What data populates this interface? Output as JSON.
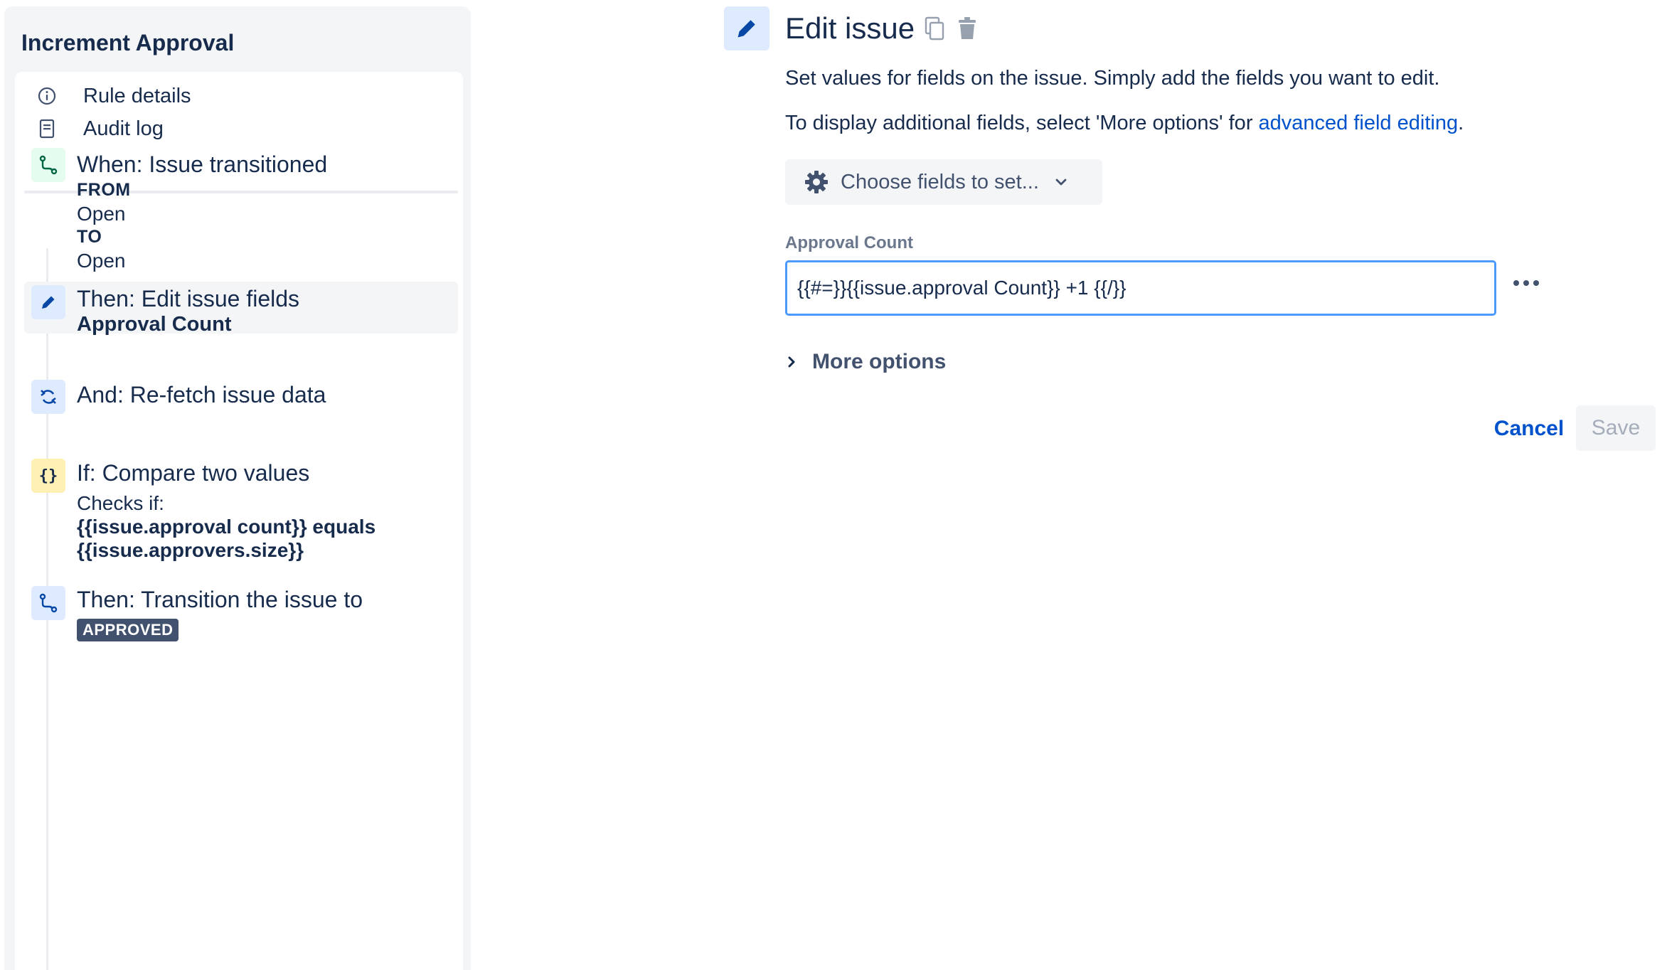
{
  "sidebar": {
    "title": "Increment Approval",
    "nav": [
      {
        "label": "Rule details",
        "icon": "info-icon"
      },
      {
        "label": "Audit log",
        "icon": "document-icon"
      }
    ],
    "components": [
      {
        "title": "When: Issue transitioned",
        "from_label": "FROM",
        "from_value": "Open",
        "to_label": "TO",
        "to_value": "Open",
        "icon": "transition-icon"
      },
      {
        "title": "Then: Edit issue fields",
        "field": "Approval Count",
        "icon": "pencil-icon",
        "selected": true
      },
      {
        "title": "And: Re-fetch issue data",
        "icon": "refresh-icon"
      },
      {
        "title": "If: Compare two values",
        "checks_label": "Checks if:",
        "expr_line1": "{{issue.approval count}} equals",
        "expr_line2": "{{issue.approvers.size}}",
        "icon": "curly-braces-icon"
      },
      {
        "title": "Then: Transition the issue to",
        "status": "APPROVED",
        "icon": "transition-icon"
      }
    ]
  },
  "main": {
    "title": "Edit issue",
    "description1": "Set values for fields on the issue. Simply add the fields you want to edit.",
    "description2_prefix": "To display additional fields, select 'More options' for ",
    "description2_link": "advanced field editing",
    "description2_suffix": ".",
    "choose_fields_label": "Choose fields to set...",
    "field_label": "Approval Count",
    "field_value": "{{#=}}{{issue.approval Count}} +1 {{/}}",
    "more_options_label": "More options",
    "cancel_label": "Cancel",
    "save_label": "Save"
  },
  "colors": {
    "primary": "#0052CC",
    "text": "#172B4D",
    "focus_border": "#4C9AFF",
    "lozenge": "#42526E"
  }
}
